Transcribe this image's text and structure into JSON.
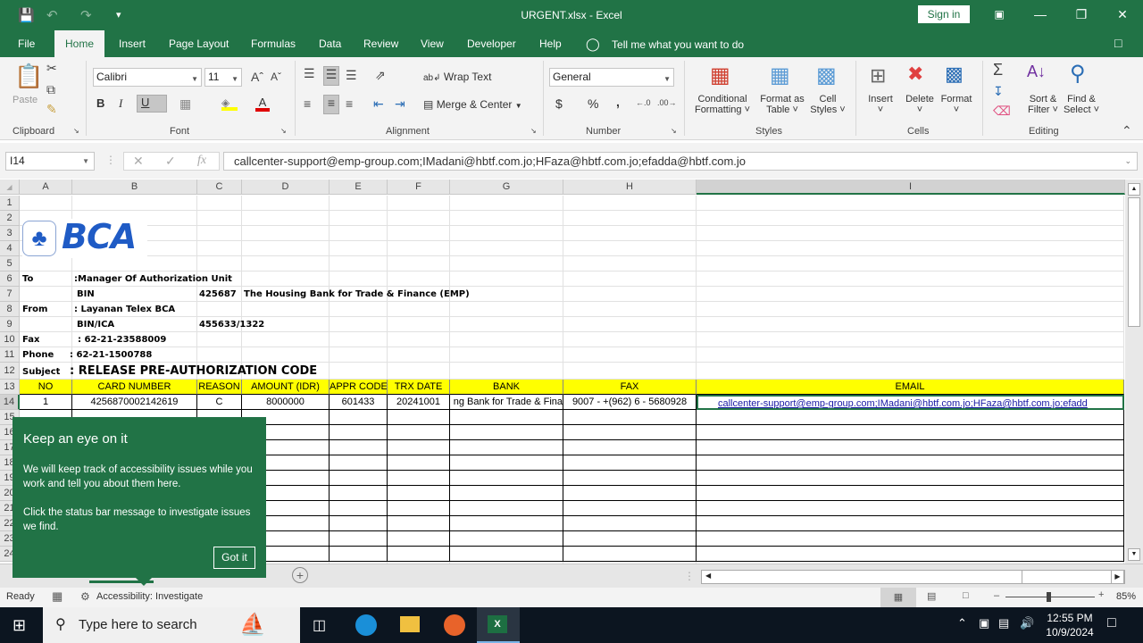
{
  "window": {
    "title": "URGENT.xlsx  -  Excel",
    "sign_in": "Sign in"
  },
  "menu": {
    "tabs": [
      "File",
      "Home",
      "Insert",
      "Page Layout",
      "Formulas",
      "Data",
      "Review",
      "View",
      "Developer",
      "Help"
    ],
    "active": "Home",
    "tell_me": "Tell me what you want to do"
  },
  "ribbon": {
    "clipboard": {
      "paste": "Paste",
      "label": "Clipboard"
    },
    "font": {
      "name": "Calibri",
      "size": "11",
      "bold": "B",
      "italic": "I",
      "underline": "U",
      "label": "Font"
    },
    "alignment": {
      "wrap_text": "Wrap Text",
      "merge_center": "Merge & Center",
      "label": "Alignment"
    },
    "number": {
      "format": "General",
      "currency": "$",
      "percent": "%",
      "comma": ",",
      "label": "Number"
    },
    "styles": {
      "conditional": "Conditional",
      "conditional2": "Formatting",
      "format_table": "Format as",
      "format_table2": "Table",
      "cell_styles": "Cell",
      "cell_styles2": "Styles",
      "label": "Styles"
    },
    "cells": {
      "insert": "Insert",
      "delete": "Delete",
      "format": "Format",
      "label": "Cells"
    },
    "editing": {
      "sort": "Sort &",
      "sort2": "Filter",
      "find": "Find &",
      "find2": "Select",
      "label": "Editing"
    }
  },
  "formula_bar": {
    "name_box": "I14",
    "formula": "callcenter-support@emp-group.com;IMadani@hbtf.com.jo;HFaza@hbtf.com.jo;efadda@hbtf.com.jo"
  },
  "sheet": {
    "columns": [
      "A",
      "B",
      "C",
      "D",
      "E",
      "F",
      "G",
      "H",
      "I"
    ],
    "selected_column": "I",
    "selected_row": "14",
    "rows": [
      "1",
      "2",
      "3",
      "4",
      "5",
      "6",
      "7",
      "8",
      "9",
      "10",
      "11",
      "12",
      "13",
      "14",
      "15",
      "16",
      "17",
      "18",
      "19",
      "20",
      "21",
      "22",
      "23",
      "24"
    ],
    "logo_text": "BCA",
    "header_info": {
      "to_label": "To",
      "to_value": ":Manager Of Authorization Unit",
      "bin_label": "BIN",
      "bin_value": "425687",
      "bank_name": "The Housing Bank for Trade & Finance (EMP)",
      "from_label": "From",
      "from_value": ": Layanan Telex BCA",
      "bin_ica_label": "BIN/ICA",
      "bin_ica_value": "455633/1322",
      "fax_label": "Fax",
      "fax_value": ": 62-21-23588009",
      "phone_label": "Phone",
      "phone_value": ": 62-21-1500788",
      "subject_label": "Subject",
      "subject_value": ": RELEASE PRE-AUTHORIZATION CODE"
    },
    "table_headers": [
      "NO",
      "CARD NUMBER",
      "REASON",
      "AMOUNT (IDR)",
      "APPR CODE",
      "TRX DATE",
      "BANK",
      "FAX",
      "EMAIL"
    ],
    "table_rows": [
      [
        "1",
        "4256870002142619",
        "C",
        "8000000",
        "601433",
        "20241001",
        "ng Bank for Trade & Fina",
        "9007 - +(962) 6 - 5680928",
        "callcenter-support@emp-group.com;IMadani@hbtf.com.jo;HFaza@hbtf.com.jo;efadd"
      ]
    ]
  },
  "popup": {
    "title": "Keep an eye on it",
    "text1": "We will keep track of accessibility issues while you work and tell you about them here.",
    "text2": "Click the status bar message to investigate issues we find.",
    "button": "Got it"
  },
  "status": {
    "ready": "Ready",
    "accessibility": "Accessibility: Investigate",
    "zoom": "85%",
    "zoom_level_percent": 85
  },
  "taskbar": {
    "search_placeholder": "Type here to search",
    "time": "12:55 PM",
    "date": "10/9/2024"
  }
}
